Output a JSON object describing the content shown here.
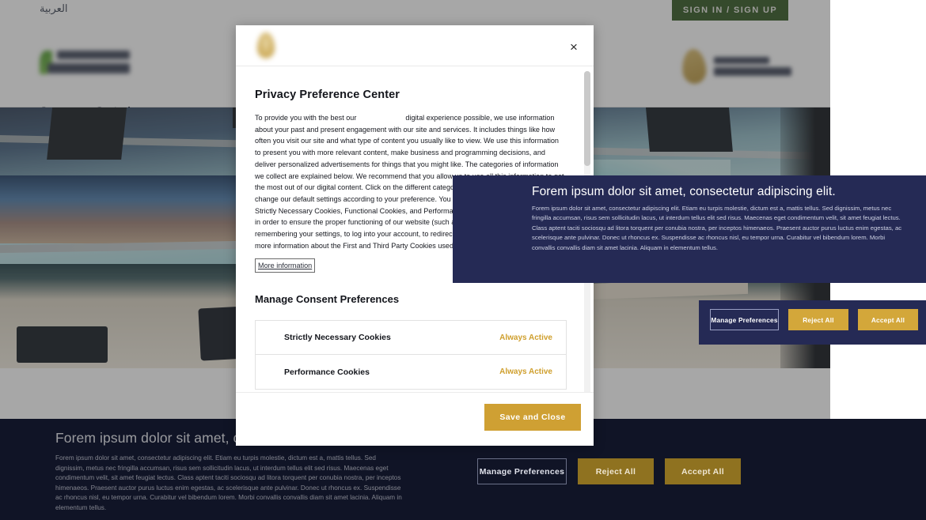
{
  "site": {
    "language_link": "العربية",
    "signin_label": "SIGN IN / SIGN UP",
    "page_title": "Course Catalogue"
  },
  "privacy_modal": {
    "title": "Privacy Preference Center",
    "close_label": "×",
    "description_part1": "To provide you with the best  our",
    "description_part2": "digital experience possible, we use information about your past and present engagement with our site and services. It includes things like how often you visit our site and what type of content you usually like to view. We use this information to present you with more relevant content, make business and programming decisions, and deliver personalized advertisements for things that you might like. The categories of information we collect are explained below. We recommend that you allow us to use all this information to get the most out of our digital content. Click on the different category headings to find out more and change our default settings according to your preference. You cannot opt-out of our First Party Strictly Necessary Cookies, Functional Cookies, and Performance Cookies as they are deployed in order to ensure the proper functioning of our website (such as prompting the cookie banner and remembering your settings, to log into your account, to redirect you when you log out, etc.). For more information about the First and Third Party Cookies used please follow this Cookie Policy.",
    "more_information_label": "More information",
    "manage_consent_heading": "Manage Consent Preferences",
    "categories": [
      {
        "name": "Strictly Necessary Cookies",
        "status": "Always Active"
      },
      {
        "name": "Performance Cookies",
        "status": "Always Active"
      }
    ],
    "save_label": "Save and Close"
  },
  "consent_overlay": {
    "title": "Forem ipsum dolor sit amet, consectetur adipiscing elit.",
    "body": "Forem ipsum dolor sit amet, consectetur adipiscing elit. Etiam eu turpis molestie, dictum est a, mattis tellus. Sed dignissim, metus nec fringilla accumsan, risus sem sollicitudin lacus, ut interdum tellus elit sed risus. Maecenas eget condimentum velit, sit amet feugiat lectus. Class aptent taciti sociosqu ad litora torquent per conubia nostra, per inceptos himenaeos. Praesent auctor purus luctus enim egestas, ac scelerisque ante pulvinar. Donec ut rhoncus ex. Suspendisse ac rhoncus nisl, eu tempor urna. Curabitur vel bibendum lorem. Morbi convallis convallis diam sit amet lacinia. Aliquam in elementum tellus.",
    "manage_label": "Manage Preferences",
    "reject_label": "Reject All",
    "accept_label": "Accept All"
  },
  "cookie_banner": {
    "title": "Forem ipsum dolor sit amet, consectetur adipiscing elit.",
    "body": "Forem ipsum dolor sit amet, consectetur adipiscing elit. Etiam eu turpis molestie, dictum est a, mattis tellus. Sed dignissim, metus nec fringilla accumsan, risus sem sollicitudin lacus, ut interdum tellus elit sed risus. Maecenas eget condimentum velit, sit amet feugiat lectus. Class aptent taciti sociosqu ad litora torquent per conubia nostra, per inceptos himenaeos. Praesent auctor purus luctus enim egestas, ac scelerisque ante pulvinar. Donec ut rhoncus ex. Suspendisse ac rhoncus nisl, eu tempor urna. Curabitur vel bibendum lorem. Morbi convallis convallis diam sit amet lacinia. Aliquam in elementum tellus.",
    "manage_label": "Manage Preferences",
    "reject_label": "Reject All",
    "accept_label": "Accept All"
  },
  "colors": {
    "gold": "#d3a73a",
    "navy": "#252a55",
    "banner_navy": "#161b33",
    "signin_green": "#31561f",
    "status_gold": "#cf9f2d"
  }
}
